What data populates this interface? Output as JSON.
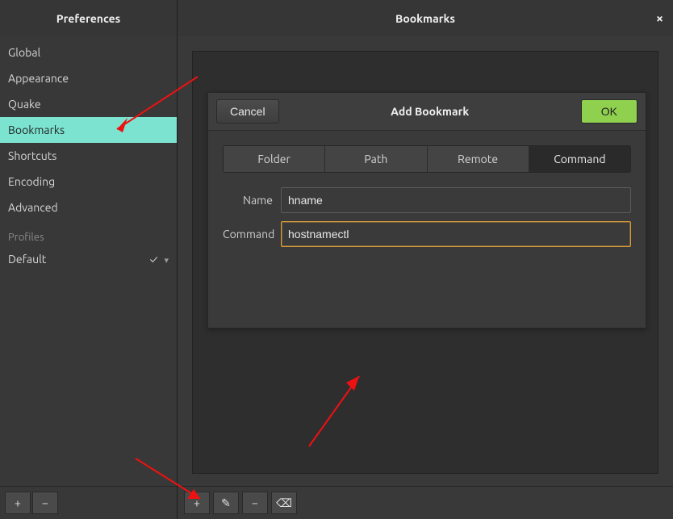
{
  "titles": {
    "left": "Preferences",
    "right": "Bookmarks"
  },
  "sidebar": {
    "items": [
      {
        "label": "Global"
      },
      {
        "label": "Appearance"
      },
      {
        "label": "Quake"
      },
      {
        "label": "Bookmarks"
      },
      {
        "label": "Shortcuts"
      },
      {
        "label": "Encoding"
      },
      {
        "label": "Advanced"
      }
    ],
    "selected_index": 3,
    "profiles_label": "Profiles",
    "profile": {
      "name": "Default"
    }
  },
  "dialog": {
    "title": "Add Bookmark",
    "cancel_label": "Cancel",
    "ok_label": "OK",
    "tabs": [
      "Folder",
      "Path",
      "Remote",
      "Command"
    ],
    "active_tab_index": 3,
    "fields": {
      "name_label": "Name",
      "name_value": "hname",
      "command_label": "Command",
      "command_value": "hostnamectl"
    }
  },
  "icons": {
    "plus": "+",
    "minus": "−",
    "edit": "✎",
    "clear": "⌫",
    "check": "✓",
    "caret_down": "▾",
    "close": "×"
  }
}
